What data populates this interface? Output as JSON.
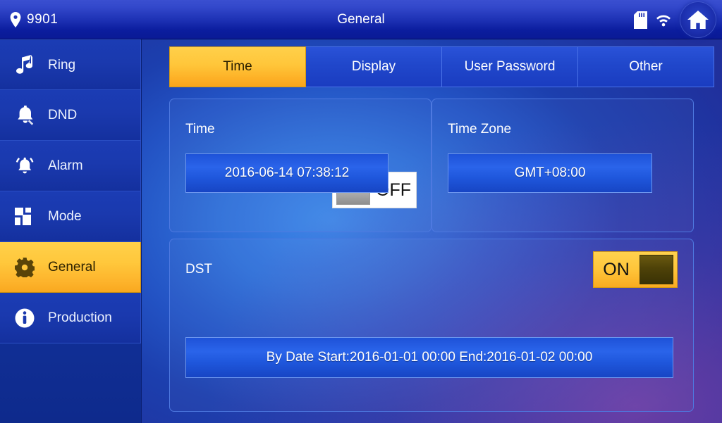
{
  "header": {
    "device_id": "9901",
    "title": "General",
    "icons": {
      "location": "location-pin-icon",
      "sdcard": "sd-card-icon",
      "wifi": "wifi-icon",
      "home": "home-icon"
    }
  },
  "sidebar": {
    "items": [
      {
        "label": "Ring",
        "icon": "music-note-icon",
        "active": false
      },
      {
        "label": "DND",
        "icon": "bell-mute-icon",
        "active": false
      },
      {
        "label": "Alarm",
        "icon": "alarm-bell-icon",
        "active": false
      },
      {
        "label": "Mode",
        "icon": "grid-icon",
        "active": false
      },
      {
        "label": "General",
        "icon": "gear-icon",
        "active": true
      },
      {
        "label": "Production",
        "icon": "info-icon",
        "active": false
      }
    ]
  },
  "tabs": [
    {
      "label": "Time",
      "active": true
    },
    {
      "label": "Display",
      "active": false
    },
    {
      "label": "User Password",
      "active": false
    },
    {
      "label": "Other",
      "active": false
    }
  ],
  "panels": {
    "time": {
      "label": "Time",
      "toggle_state": "OFF",
      "value": "2016-06-14 07:38:12"
    },
    "timezone": {
      "label": "Time Zone",
      "value": "GMT+08:00"
    },
    "dst": {
      "label": "DST",
      "toggle_state": "ON",
      "value": "By Date  Start:2016-01-01 00:00  End:2016-01-02 00:00"
    }
  },
  "colors": {
    "accent_yellow": "#ffc63a",
    "header_blue": "#1d31b4",
    "panel_border": "#4e79e0",
    "value_blue": "#2a64ea",
    "text_white": "#ffffff"
  }
}
